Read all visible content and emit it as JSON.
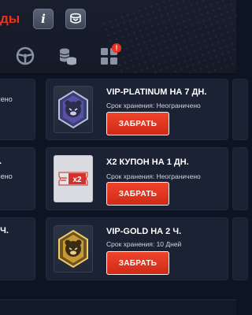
{
  "header": {
    "title": "ды",
    "info_label": "i"
  },
  "tabs": [
    {
      "icon": "steering-wheel-icon"
    },
    {
      "icon": "coins-icon"
    },
    {
      "icon": "grid-icon",
      "badge": "!"
    }
  ],
  "left_column": [
    {
      "title": "",
      "subtitle": "ичено"
    },
    {
      "title": "Н.",
      "subtitle": "ичено"
    },
    {
      "title": "2 Ч.",
      "subtitle": ""
    }
  ],
  "items": [
    {
      "title": "VIP-PLATINUM НА 7 ДН.",
      "meta": "Срок хранения: Неограничено",
      "button": "ЗАБРАТЬ",
      "icon": "vip-platinum-bear-icon"
    },
    {
      "title": "X2 КУПОН НА 1 ДН.",
      "meta": "Срок хранения: Неограничено",
      "button": "ЗАБРАТЬ",
      "icon": "x2-coupon-icon",
      "coupon_label": "x2"
    },
    {
      "title": "VIP-GOLD НА 2 Ч.",
      "meta": "Срок хранения: 10 Дней",
      "button": "ЗАБРАТЬ",
      "icon": "vip-gold-bear-icon"
    }
  ],
  "colors": {
    "accent": "#e8341f",
    "background": "#0d1422",
    "card": "#1a2233"
  }
}
